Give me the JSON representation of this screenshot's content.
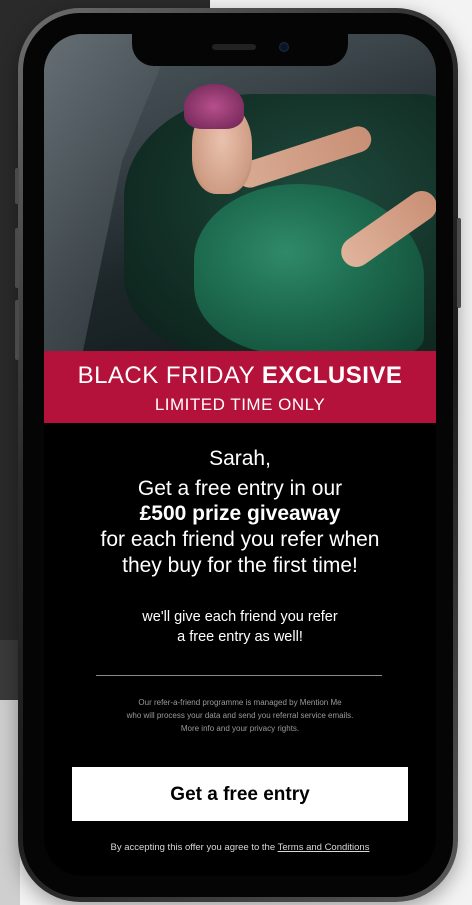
{
  "banner": {
    "line1_light": "BLACK FRIDAY ",
    "line1_bold": "EXCLUSIVE",
    "line2": "LIMITED TIME ONLY"
  },
  "offer": {
    "greeting": "Sarah,",
    "line1": "Get a free entry in our",
    "line2_bold": "£500 prize giveaway",
    "line3": "for each friend you refer when",
    "line4": "they buy for the first time!"
  },
  "bonus": {
    "line1": "we'll give each friend you refer",
    "line2": "a free entry as well!"
  },
  "privacy": {
    "line1": "Our refer-a-friend programme is managed by Mention Me",
    "line2": "who will process your data and send you referral service emails.",
    "line3": "More info and your privacy rights."
  },
  "cta": {
    "label": "Get a free entry"
  },
  "footer": {
    "text": "By accepting this offer you agree to the ",
    "terms_link": "Terms and Conditions"
  },
  "colors": {
    "banner": "#b5123b",
    "screen_bg": "#000000",
    "button_bg": "#ffffff"
  }
}
